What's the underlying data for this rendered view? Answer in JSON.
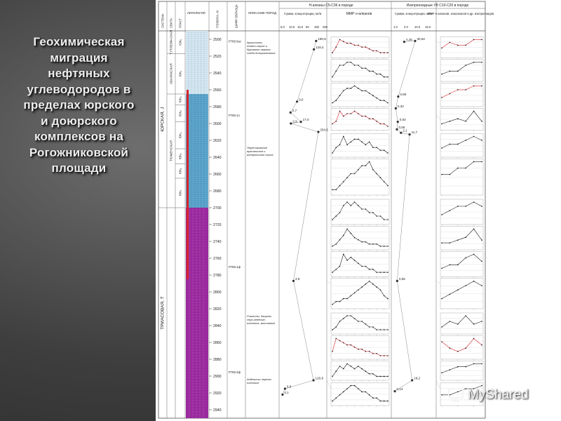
{
  "slide": {
    "title_lines": [
      "Геохимическая",
      "миграция",
      "нефтяных",
      "углеводородов в",
      "пределах юрского",
      "и доюрского",
      "комплексов на",
      "Рогожниковской",
      "площади"
    ]
  },
  "headers": {
    "system": "СИСТЕМА",
    "suite": "СВИТА",
    "layer": "ПЛАСТ",
    "lithology": "ЛИТОЛОГИЯ",
    "depth": "ГЛУБИНА, М",
    "sample": "ШИФР ОБРАЗЦА",
    "rock_desc": "ОПИСАНИЕ ПОРОД",
    "nalkanes_group": "Н-алканы C5-C36 в породе",
    "nalkanes_sum": "Сумма, концентрации, мг/кг",
    "nalkanes_mmr": "ММР н-алканов",
    "iso_group": "Изопреноидные УВ C10-C20 в породе",
    "iso_sum": "Сумма, концентрации, мг/кг",
    "iso_mmr": "ММР н-алканов, изоалканов и др. изопреноидов"
  },
  "stratigraphy": {
    "systems": [
      {
        "label": "ЮРСКАЯ, J",
        "top_m": 2490,
        "bottom_m": 2700
      },
      {
        "label": "ТРИАСОВАЯ, T",
        "top_m": 2700,
        "bottom_m": 2950
      }
    ],
    "suites": [
      {
        "label": "ТУТЛЕИМ-СКАЯ",
        "top_m": 2490,
        "bottom_m": 2517
      },
      {
        "label": "АБАЛАКСКАЯ",
        "top_m": 2517,
        "bottom_m": 2565
      },
      {
        "label": "ТЮМЕНСКАЯ",
        "top_m": 2565,
        "bottom_m": 2700
      }
    ],
    "layers": [
      {
        "label": "ЮК₀",
        "top_m": 2490,
        "bottom_m": 2517
      },
      {
        "label": "ЮК₁",
        "top_m": 2517,
        "bottom_m": 2565
      },
      {
        "label": "ЮК₂",
        "top_m": 2565,
        "bottom_m": 2578
      },
      {
        "label": "ЮК₃",
        "top_m": 2578,
        "bottom_m": 2598
      },
      {
        "label": "ЮК₄",
        "top_m": 2598,
        "bottom_m": 2630
      },
      {
        "label": "ЮК₅",
        "top_m": 2630,
        "bottom_m": 2648
      },
      {
        "label": "ЮК₆",
        "top_m": 2648,
        "bottom_m": 2665
      },
      {
        "label": "ЮК₇",
        "top_m": 2665,
        "bottom_m": 2700
      }
    ]
  },
  "depth_scale": {
    "min_m": 2490,
    "max_m": 2950,
    "ticks": [
      2500,
      2520,
      2540,
      2560,
      2580,
      2600,
      2620,
      2640,
      2660,
      2680,
      2700,
      2720,
      2740,
      2760,
      2780,
      2800,
      2820,
      2840,
      2860,
      2880,
      2900,
      2920,
      2940
    ]
  },
  "lithology": [
    {
      "top_m": 2490,
      "bottom_m": 2565,
      "color": "#d6e7f1",
      "kind": "shale"
    },
    {
      "top_m": 2565,
      "bottom_m": 2700,
      "color": "#5ea6cc",
      "kind": "sandstone"
    },
    {
      "top_m": 2700,
      "bottom_m": 2950,
      "color": "#9a2a9d",
      "kind": "basement"
    }
  ],
  "red_interval": {
    "top_m": 2560,
    "bottom_m": 2785,
    "color": "#d8232a"
  },
  "samples": [
    {
      "label": "Р765-5ас",
      "depth_m": 2502
    },
    {
      "label": "Р765-1п",
      "depth_m": 2590
    },
    {
      "label": "Р765-1ф",
      "depth_m": 2770
    },
    {
      "label": "Р765-3ф",
      "depth_m": 2895
    }
  ],
  "descriptions": [
    {
      "text": "Аргиллиты темно-серые и буровато-черные, слабо-битуминозные",
      "depth_m": 2505
    },
    {
      "text": "Переслаивание аргиллитов и алевролитов серых",
      "depth_m": 2630
    },
    {
      "text": "Риолиты, дациты серо-зелёные, плотные, массивные",
      "depth_m": 2830
    },
    {
      "text": "Андезиты черные, плотные",
      "depth_m": 2905
    }
  ],
  "nalkanes_scale": [
    "5.0",
    "10.0",
    "15.0",
    "50",
    "150",
    "250"
  ],
  "iso_scale": [
    "1.0",
    "2.0",
    "10.0",
    "15.0"
  ],
  "nalkanes_points": [
    {
      "value": "180,6",
      "depth_m": 2502
    },
    {
      "value": "128,4",
      "depth_m": 2512
    },
    {
      "value": "9,0",
      "depth_m": 2574
    },
    {
      "value": "2,7",
      "depth_m": 2587
    },
    {
      "value": "17,0",
      "depth_m": 2598
    },
    {
      "value": "2,9",
      "depth_m": 2600
    },
    {
      "value": "254,5",
      "depth_m": 2610
    },
    {
      "value": "4,8",
      "depth_m": 2787
    },
    {
      "value": "120,8",
      "depth_m": 2905
    },
    {
      "value": "0,6",
      "depth_m": 2915
    },
    {
      "value": "0,1",
      "depth_m": 2922
    }
  ],
  "iso_points": [
    {
      "value": "4,25",
      "depth_m": 2503
    },
    {
      "value": "30,62",
      "depth_m": 2502
    },
    {
      "value": "0,96",
      "depth_m": 2568
    },
    {
      "value": "0,32",
      "depth_m": 2582
    },
    {
      "value": "0,83",
      "depth_m": 2598
    },
    {
      "value": "0,58",
      "depth_m": 2607
    },
    {
      "value": "2,1",
      "depth_m": 2611
    },
    {
      "value": "11,7",
      "depth_m": 2613
    },
    {
      "value": "0,65",
      "depth_m": 2787
    },
    {
      "value": "18,2",
      "depth_m": 2905
    },
    {
      "value": "0,13",
      "depth_m": 2918
    }
  ],
  "mmr_panels": [
    {
      "top_m": 2497,
      "bottom_m": 2522,
      "values": [
        2,
        5,
        9,
        8,
        7,
        7,
        6,
        6,
        5,
        5,
        4,
        3,
        3,
        2,
        2,
        2
      ],
      "accent": true
    },
    {
      "top_m": 2524,
      "bottom_m": 2550,
      "values": [
        1,
        3,
        5,
        5,
        6,
        6,
        5,
        5,
        4,
        4,
        3,
        3,
        2,
        2,
        1,
        1
      ],
      "accent": false
    },
    {
      "top_m": 2552,
      "bottom_m": 2580,
      "values": [
        1,
        2,
        4,
        6,
        7,
        7,
        8,
        7,
        6,
        6,
        5,
        4,
        3,
        2,
        2,
        1
      ],
      "accent": false
    },
    {
      "top_m": 2582,
      "bottom_m": 2608,
      "values": [
        2,
        3,
        7,
        5,
        6,
        6,
        7,
        6,
        5,
        5,
        4,
        4,
        3,
        2,
        2,
        1
      ],
      "accent": true
    },
    {
      "top_m": 2612,
      "bottom_m": 2640,
      "values": [
        1,
        3,
        4,
        7,
        4,
        5,
        6,
        6,
        5,
        4,
        5,
        3,
        3,
        2,
        2,
        1
      ],
      "accent": false
    },
    {
      "top_m": 2642,
      "bottom_m": 2685,
      "values": [
        1,
        1,
        2,
        3,
        4,
        5,
        5,
        6,
        7,
        7,
        8,
        6,
        5,
        4,
        3,
        2
      ],
      "accent": false
    },
    {
      "top_m": 2690,
      "bottom_m": 2720,
      "values": [
        1,
        2,
        3,
        5,
        6,
        5,
        6,
        5,
        4,
        4,
        3,
        3,
        2,
        2,
        1,
        1
      ],
      "accent": false
    },
    {
      "top_m": 2722,
      "bottom_m": 2750,
      "values": [
        1,
        2,
        4,
        6,
        9,
        7,
        5,
        4,
        3,
        3,
        2,
        2,
        2,
        1,
        1,
        1
      ],
      "accent": false
    },
    {
      "top_m": 2752,
      "bottom_m": 2782,
      "values": [
        1,
        2,
        3,
        7,
        5,
        6,
        5,
        4,
        3,
        3,
        2,
        2,
        1,
        1,
        1,
        1
      ],
      "accent": false
    },
    {
      "top_m": 2784,
      "bottom_m": 2820,
      "values": [
        1,
        2,
        2,
        3,
        3,
        4,
        5,
        6,
        7,
        8,
        9,
        8,
        7,
        6,
        4,
        3
      ],
      "accent": false
    },
    {
      "top_m": 2825,
      "bottom_m": 2850,
      "values": [
        1,
        2,
        4,
        5,
        6,
        6,
        5,
        4,
        4,
        3,
        2,
        2,
        1,
        1,
        1,
        1
      ],
      "accent": false
    },
    {
      "top_m": 2852,
      "bottom_m": 2880,
      "values": [
        3,
        9,
        8,
        7,
        6,
        6,
        5,
        4,
        4,
        3,
        3,
        2,
        2,
        1,
        1,
        1
      ],
      "accent": true
    },
    {
      "top_m": 2882,
      "bottom_m": 2905,
      "values": [
        1,
        3,
        5,
        4,
        6,
        5,
        4,
        5,
        4,
        3,
        2,
        2,
        1,
        1,
        1,
        1
      ],
      "accent": false
    },
    {
      "top_m": 2908,
      "bottom_m": 2935,
      "values": [
        1,
        2,
        3,
        4,
        5,
        6,
        6,
        5,
        4,
        4,
        3,
        2,
        2,
        1,
        1,
        1
      ],
      "accent": false
    }
  ],
  "iso_panels": [
    {
      "top_m": 2497,
      "bottom_m": 2522,
      "values": [
        3,
        5,
        4,
        4,
        6,
        6
      ],
      "accent": true
    },
    {
      "top_m": 2524,
      "bottom_m": 2550,
      "values": [
        2,
        3,
        3,
        5,
        6,
        6
      ],
      "accent": false
    },
    {
      "top_m": 2552,
      "bottom_m": 2580,
      "values": [
        2,
        3,
        4,
        4,
        5,
        5
      ],
      "accent": true
    },
    {
      "top_m": 2582,
      "bottom_m": 2608,
      "values": [
        2,
        3,
        4,
        3,
        7,
        3
      ],
      "accent": false
    },
    {
      "top_m": 2612,
      "bottom_m": 2640,
      "values": [
        2,
        3,
        3,
        4,
        5,
        4
      ],
      "accent": false
    },
    {
      "top_m": 2642,
      "bottom_m": 2685,
      "values": [
        3,
        3,
        4,
        4,
        5,
        5
      ],
      "accent": false
    },
    {
      "top_m": 2690,
      "bottom_m": 2720,
      "values": [
        2,
        3,
        4,
        4,
        5,
        4
      ],
      "accent": false
    },
    {
      "top_m": 2722,
      "bottom_m": 2750,
      "values": [
        2,
        2,
        3,
        4,
        7,
        3
      ],
      "accent": false
    },
    {
      "top_m": 2752,
      "bottom_m": 2782,
      "values": [
        2,
        3,
        3,
        5,
        6,
        4
      ],
      "accent": false
    },
    {
      "top_m": 2784,
      "bottom_m": 2820,
      "values": [
        2,
        3,
        4,
        5,
        6,
        5
      ],
      "accent": false
    },
    {
      "top_m": 2825,
      "bottom_m": 2850,
      "values": [
        2,
        4,
        3,
        6,
        3,
        4
      ],
      "accent": false
    },
    {
      "top_m": 2852,
      "bottom_m": 2880,
      "values": [
        5,
        3,
        2,
        3,
        6,
        4
      ],
      "accent": true
    },
    {
      "top_m": 2882,
      "bottom_m": 2905,
      "values": [
        2,
        3,
        4,
        4,
        5,
        5
      ],
      "accent": false
    },
    {
      "top_m": 2908,
      "bottom_m": 2935,
      "values": [
        3,
        3,
        4,
        5,
        5,
        6
      ],
      "accent": false
    }
  ],
  "colors": {
    "line": "#222222",
    "accent": "#d8232a",
    "grid": "#cccccc"
  },
  "watermark": {
    "text": "MyShared",
    "icon": "presentation-icon"
  }
}
